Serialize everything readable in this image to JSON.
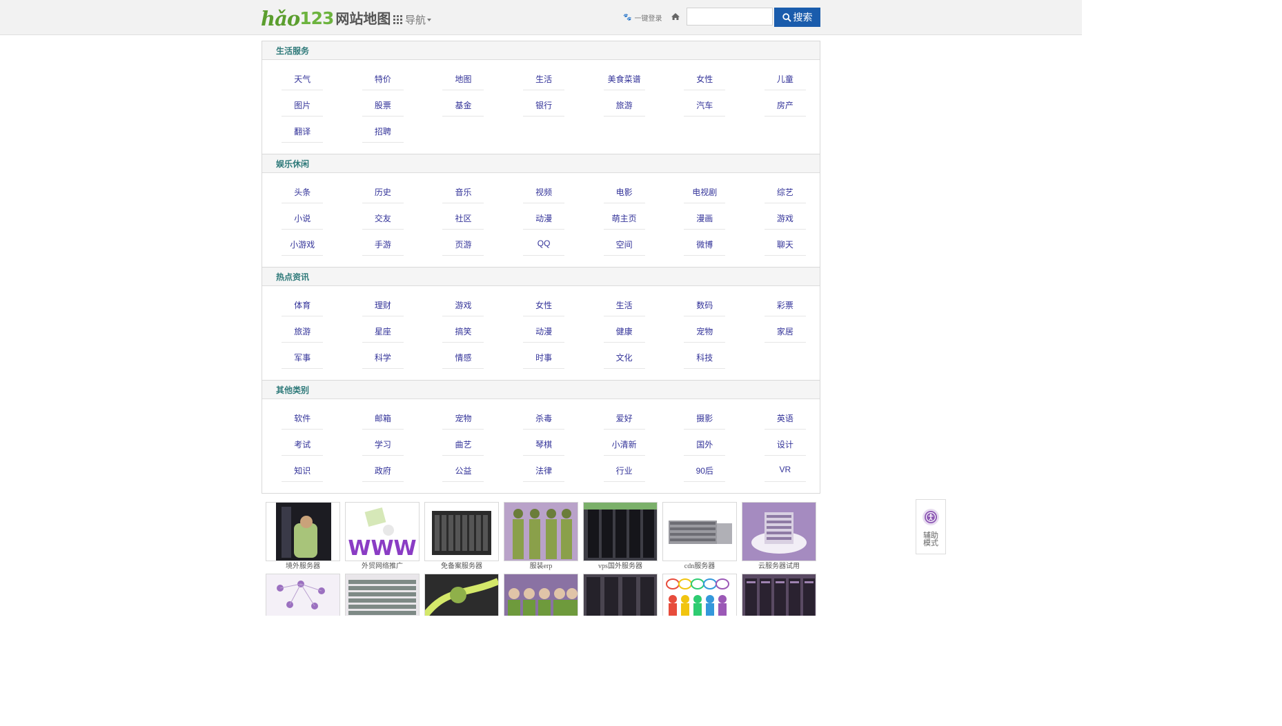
{
  "header": {
    "logo_hao": "hǎo",
    "logo_num": "123",
    "logo_sub": "网站地图",
    "nav_label": "导航",
    "login_label": "一键登录",
    "search_placeholder": "",
    "search_button": "搜索",
    "accent": "#1a5cac"
  },
  "sections": [
    {
      "title": "生活服务",
      "links": [
        "天气",
        "特价",
        "地图",
        "生活",
        "美食菜谱",
        "女性",
        "儿童",
        "图片",
        "股票",
        "基金",
        "银行",
        "旅游",
        "汽车",
        "房产",
        "翻译",
        "招聘"
      ]
    },
    {
      "title": "娱乐休闲",
      "links": [
        "头条",
        "历史",
        "音乐",
        "视频",
        "电影",
        "电视剧",
        "综艺",
        "小说",
        "交友",
        "社区",
        "动漫",
        "萌主页",
        "漫画",
        "游戏",
        "小游戏",
        "手游",
        "页游",
        "QQ",
        "空间",
        "微博",
        "聊天"
      ]
    },
    {
      "title": "热点资讯",
      "links": [
        "体育",
        "理财",
        "游戏",
        "女性",
        "生活",
        "数码",
        "彩票",
        "旅游",
        "星座",
        "搞笑",
        "动漫",
        "健康",
        "宠物",
        "家居",
        "军事",
        "科学",
        "情感",
        "时事",
        "文化",
        "科技"
      ]
    },
    {
      "title": "其他类别",
      "links": [
        "软件",
        "邮箱",
        "宠物",
        "杀毒",
        "爱好",
        "摄影",
        "英语",
        "考试",
        "学习",
        "曲艺",
        "琴棋",
        "小清新",
        "国外",
        "设计",
        "知识",
        "政府",
        "公益",
        "法律",
        "行业",
        "90后",
        "VR"
      ]
    }
  ],
  "ads_row1": [
    {
      "caption": "境外服务器",
      "icon": "server-rack-image"
    },
    {
      "caption": "外贸网络推广",
      "icon": "www-figure-image"
    },
    {
      "caption": "免备案服务器",
      "icon": "blade-server-image"
    },
    {
      "caption": "服装erp",
      "icon": "fashion-models-image"
    },
    {
      "caption": "vps国外服务器",
      "icon": "datacenter-image"
    },
    {
      "caption": "cdn服务器",
      "icon": "rack-units-image"
    },
    {
      "caption": "云服务器试用",
      "icon": "cloud-server-image"
    }
  ],
  "ads_row2": [
    {
      "icon": "network-people-image"
    },
    {
      "icon": "storage-array-image"
    },
    {
      "icon": "cable-hand-image"
    },
    {
      "icon": "team-photo-image"
    },
    {
      "icon": "server-room-image"
    },
    {
      "icon": "speech-bubbles-image"
    },
    {
      "icon": "server-cabinets-image"
    }
  ],
  "assist": {
    "label_line1": "辅助",
    "label_line2": "模式",
    "icon": "accessibility-icon"
  },
  "colors": {
    "link": "#333399",
    "section_title": "#2f7a7a",
    "ad_tint": "#9b59b6"
  }
}
